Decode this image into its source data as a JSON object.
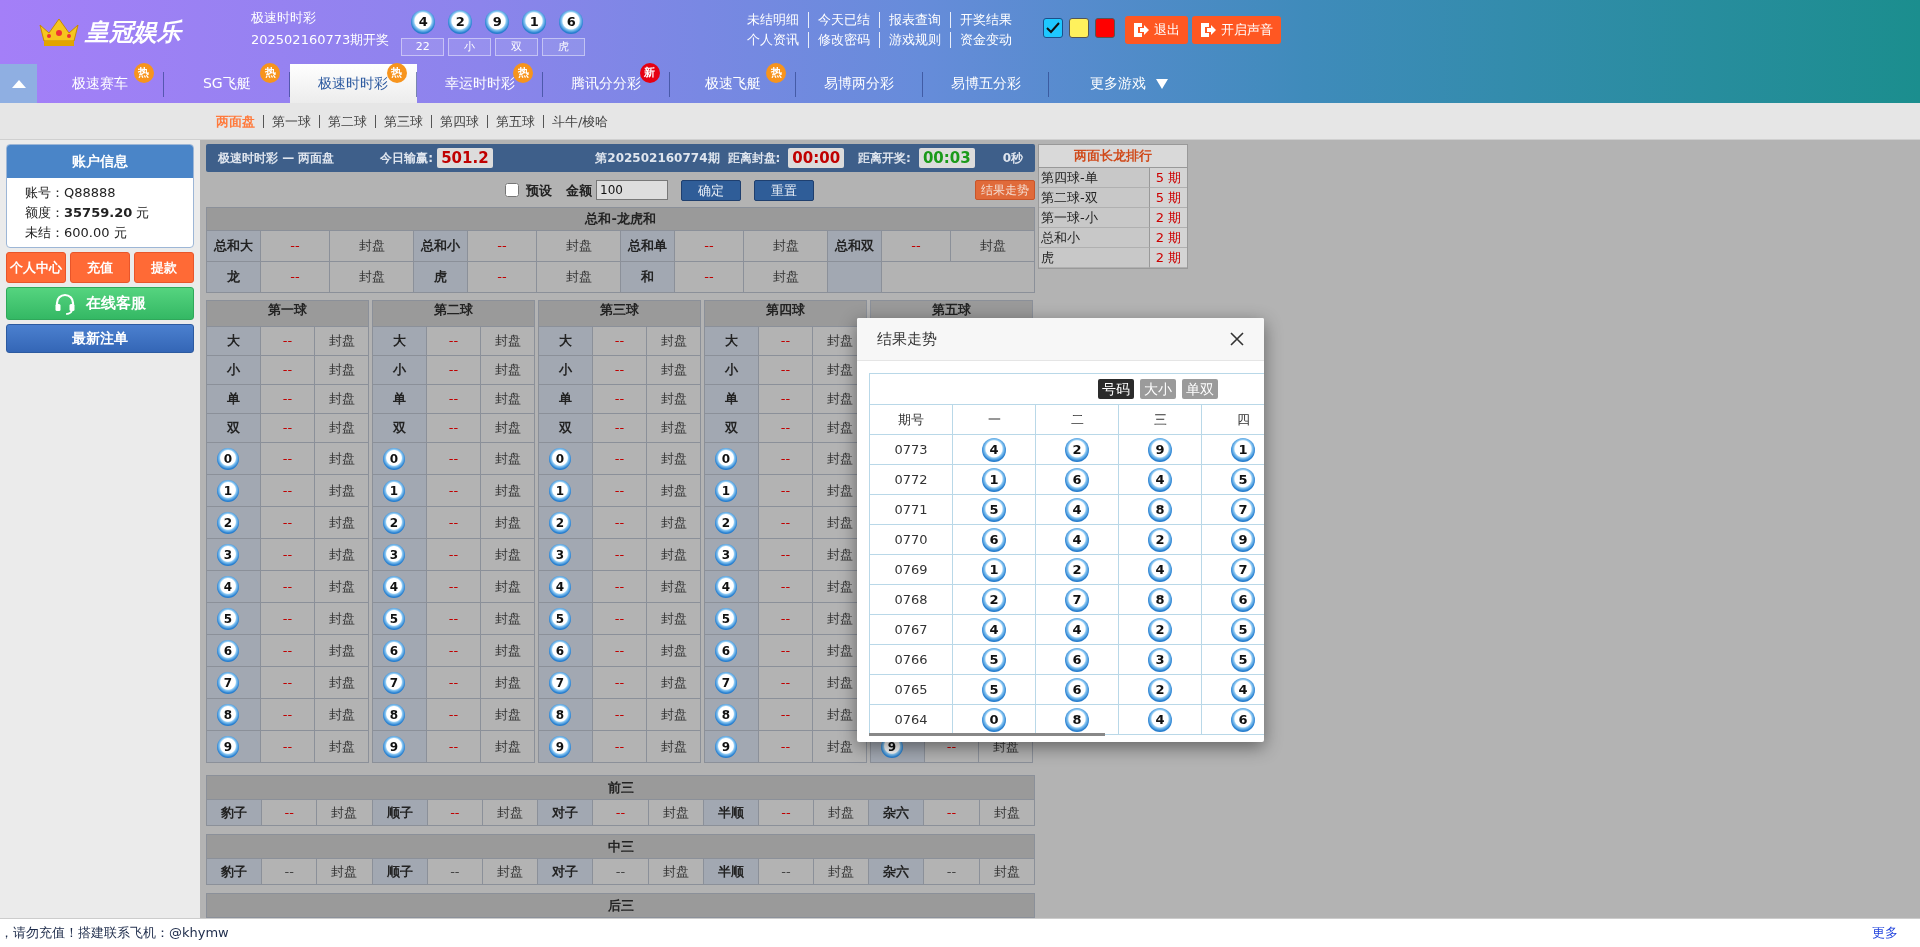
{
  "header": {
    "logo": "皇冠娱乐",
    "game": "极速时时彩",
    "draw_label": "202502160773期开奖",
    "balls": [
      "4",
      "2",
      "9",
      "1",
      "6"
    ],
    "summary": [
      "22",
      "小",
      "双",
      "虎"
    ],
    "links": [
      [
        "未结明细",
        "今天已结",
        "报表查询",
        "开奖结果"
      ],
      [
        "个人资讯",
        "修改密码",
        "游戏规则",
        "资金变动"
      ]
    ],
    "themes": [
      {
        "color": "#1ec8ff",
        "selected": true
      },
      {
        "color": "#fff15c",
        "selected": false
      },
      {
        "color": "#ff0000",
        "selected": false
      }
    ],
    "buttons": [
      "退出",
      "开启声音"
    ]
  },
  "nav": {
    "tabs": [
      {
        "label": "极速赛车",
        "selected": false,
        "badge": {
          "text": "热",
          "color": "#f7941d"
        }
      },
      {
        "label": "SG飞艇",
        "selected": false,
        "badge": {
          "text": "热",
          "color": "#f7941d"
        }
      },
      {
        "label": "极速时时彩",
        "selected": true,
        "badge": {
          "text": "热",
          "color": "#f7941d"
        }
      },
      {
        "label": "幸运时时彩",
        "selected": false,
        "badge": {
          "text": "热",
          "color": "#f7941d"
        }
      },
      {
        "label": "腾讯分分彩",
        "selected": false,
        "badge": {
          "text": "新",
          "color": "#e60012"
        }
      },
      {
        "label": "极速飞艇",
        "selected": false,
        "badge": {
          "text": "热",
          "color": "#f7941d"
        }
      },
      {
        "label": "易博两分彩",
        "selected": false
      },
      {
        "label": "易博五分彩",
        "selected": false
      }
    ],
    "more": "更多游戏"
  },
  "subnav": [
    {
      "label": "两面盘",
      "selected": true
    },
    {
      "label": "第一球",
      "selected": false
    },
    {
      "label": "第二球",
      "selected": false
    },
    {
      "label": "第三球",
      "selected": false
    },
    {
      "label": "第四球",
      "selected": false
    },
    {
      "label": "第五球",
      "selected": false
    },
    {
      "label": "斗牛/梭哈",
      "selected": false
    }
  ],
  "account": {
    "title": "账户信息",
    "lines": [
      "账号：Q88888",
      "额度：**35759.20** 元",
      "未结：600.00 元"
    ],
    "buttons": [
      "个人中心",
      "充值",
      "提款"
    ],
    "service": "在线客服",
    "latest": "最新注单"
  },
  "info_bar": {
    "title": "极速时时彩 — 两面盘",
    "profit_label": "今日输赢:",
    "profit": "501.2",
    "period": "第202502160774期",
    "close_label": "距离封盘:",
    "close_time": "00:00",
    "open_label": "距离开奖:",
    "open_time": "00:03",
    "seconds": "0秒"
  },
  "controls": {
    "preset": {
      "label": "预设",
      "checked": false
    },
    "amount_label": "金额",
    "amount": "100",
    "buttons": [
      "确定",
      "重置"
    ],
    "trend_button": "结果走势"
  },
  "sum_table": {
    "title": "总和-龙虎和",
    "rows": [
      [
        {
          "label": "总和大",
          "odds": "--",
          "status": "封盘"
        },
        {
          "label": "总和小",
          "odds": "--",
          "status": "封盘"
        },
        {
          "label": "总和单",
          "odds": "--",
          "status": "封盘"
        },
        {
          "label": "总和双",
          "odds": "--",
          "status": "封盘"
        }
      ],
      [
        {
          "label": "龙",
          "odds": "--",
          "status": "封盘"
        },
        {
          "label": "虎",
          "odds": "--",
          "status": "封盘"
        },
        {
          "label": "和",
          "odds": "--",
          "status": "封盘"
        }
      ]
    ]
  },
  "ball_tables": [
    {
      "title": "第一球",
      "rows": [
        {
          "kind": "text",
          "label": "大",
          "odds": "--",
          "status": "封盘"
        },
        {
          "kind": "text",
          "label": "小",
          "odds": "--",
          "status": "封盘"
        },
        {
          "kind": "text",
          "label": "单",
          "odds": "--",
          "status": "封盘"
        },
        {
          "kind": "text",
          "label": "双",
          "odds": "--",
          "status": "封盘"
        },
        {
          "kind": "ball",
          "label": "0",
          "odds": "--",
          "status": "封盘"
        },
        {
          "kind": "ball",
          "label": "1",
          "odds": "--",
          "status": "封盘"
        },
        {
          "kind": "ball",
          "label": "2",
          "odds": "--",
          "status": "封盘"
        },
        {
          "kind": "ball",
          "label": "3",
          "odds": "--",
          "status": "封盘"
        },
        {
          "kind": "ball",
          "label": "4",
          "odds": "--",
          "status": "封盘"
        },
        {
          "kind": "ball",
          "label": "5",
          "odds": "--",
          "status": "封盘"
        },
        {
          "kind": "ball",
          "label": "6",
          "odds": "--",
          "status": "封盘"
        },
        {
          "kind": "ball",
          "label": "7",
          "odds": "--",
          "status": "封盘"
        },
        {
          "kind": "ball",
          "label": "8",
          "odds": "--",
          "status": "封盘"
        },
        {
          "kind": "ball",
          "label": "9",
          "odds": "--",
          "status": "封盘"
        }
      ]
    },
    {
      "title": "第二球",
      "rows": [
        {
          "kind": "text",
          "label": "大",
          "odds": "--",
          "status": "封盘"
        },
        {
          "kind": "text",
          "label": "小",
          "odds": "--",
          "status": "封盘"
        },
        {
          "kind": "text",
          "label": "单",
          "odds": "--",
          "status": "封盘"
        },
        {
          "kind": "text",
          "label": "双",
          "odds": "--",
          "status": "封盘"
        },
        {
          "kind": "ball",
          "label": "0",
          "odds": "--",
          "status": "封盘"
        },
        {
          "kind": "ball",
          "label": "1",
          "odds": "--",
          "status": "封盘"
        },
        {
          "kind": "ball",
          "label": "2",
          "odds": "--",
          "status": "封盘"
        },
        {
          "kind": "ball",
          "label": "3",
          "odds": "--",
          "status": "封盘"
        },
        {
          "kind": "ball",
          "label": "4",
          "odds": "--",
          "status": "封盘"
        },
        {
          "kind": "ball",
          "label": "5",
          "odds": "--",
          "status": "封盘"
        },
        {
          "kind": "ball",
          "label": "6",
          "odds": "--",
          "status": "封盘"
        },
        {
          "kind": "ball",
          "label": "7",
          "odds": "--",
          "status": "封盘"
        },
        {
          "kind": "ball",
          "label": "8",
          "odds": "--",
          "status": "封盘"
        },
        {
          "kind": "ball",
          "label": "9",
          "odds": "--",
          "status": "封盘"
        }
      ]
    },
    {
      "title": "第三球",
      "rows": [
        {
          "kind": "text",
          "label": "大",
          "odds": "--",
          "status": "封盘"
        },
        {
          "kind": "text",
          "label": "小",
          "odds": "--",
          "status": "封盘"
        },
        {
          "kind": "text",
          "label": "单",
          "odds": "--",
          "status": "封盘"
        },
        {
          "kind": "text",
          "label": "双",
          "odds": "--",
          "status": "封盘"
        },
        {
          "kind": "ball",
          "label": "0",
          "odds": "--",
          "status": "封盘"
        },
        {
          "kind": "ball",
          "label": "1",
          "odds": "--",
          "status": "封盘"
        },
        {
          "kind": "ball",
          "label": "2",
          "odds": "--",
          "status": "封盘"
        },
        {
          "kind": "ball",
          "label": "3",
          "odds": "--",
          "status": "封盘"
        },
        {
          "kind": "ball",
          "label": "4",
          "odds": "--",
          "status": "封盘"
        },
        {
          "kind": "ball",
          "label": "5",
          "odds": "--",
          "status": "封盘"
        },
        {
          "kind": "ball",
          "label": "6",
          "odds": "--",
          "status": "封盘"
        },
        {
          "kind": "ball",
          "label": "7",
          "odds": "--",
          "status": "封盘"
        },
        {
          "kind": "ball",
          "label": "8",
          "odds": "--",
          "status": "封盘"
        },
        {
          "kind": "ball",
          "label": "9",
          "odds": "--",
          "status": "封盘"
        }
      ]
    },
    {
      "title": "第四球",
      "rows": [
        {
          "kind": "text",
          "label": "大",
          "odds": "--",
          "status": "封盘"
        },
        {
          "kind": "text",
          "label": "小",
          "odds": "--",
          "status": "封盘"
        },
        {
          "kind": "text",
          "label": "单",
          "odds": "--",
          "status": "封盘"
        },
        {
          "kind": "text",
          "label": "双",
          "odds": "--",
          "status": "封盘"
        },
        {
          "kind": "ball",
          "label": "0",
          "odds": "--",
          "status": "封盘"
        },
        {
          "kind": "ball",
          "label": "1",
          "odds": "--",
          "status": "封盘"
        },
        {
          "kind": "ball",
          "label": "2",
          "odds": "--",
          "status": "封盘"
        },
        {
          "kind": "ball",
          "label": "3",
          "odds": "--",
          "status": "封盘"
        },
        {
          "kind": "ball",
          "label": "4",
          "odds": "--",
          "status": "封盘"
        },
        {
          "kind": "ball",
          "label": "5",
          "odds": "--",
          "status": "封盘"
        },
        {
          "kind": "ball",
          "label": "6",
          "odds": "--",
          "status": "封盘"
        },
        {
          "kind": "ball",
          "label": "7",
          "odds": "--",
          "status": "封盘"
        },
        {
          "kind": "ball",
          "label": "8",
          "odds": "--",
          "status": "封盘"
        },
        {
          "kind": "ball",
          "label": "9",
          "odds": "--",
          "status": "封盘"
        }
      ]
    },
    {
      "title": "第五球",
      "rows": [
        {
          "kind": "ball",
          "label": "9",
          "odds": "--",
          "status": "封盘"
        }
      ]
    }
  ],
  "sections": [
    {
      "title": "前三",
      "active": true,
      "cells": [
        {
          "label": "豹子",
          "odds": "--",
          "status": "封盘"
        },
        {
          "label": "顺子",
          "odds": "--",
          "status": "封盘"
        },
        {
          "label": "对子",
          "odds": "--",
          "status": "封盘"
        },
        {
          "label": "半顺",
          "odds": "--",
          "status": "封盘"
        },
        {
          "label": "杂六",
          "odds": "--",
          "status": "封盘"
        }
      ]
    },
    {
      "title": "中三",
      "active": false,
      "cells": [
        {
          "label": "豹子",
          "odds": "--",
          "status": "封盘"
        },
        {
          "label": "顺子",
          "odds": "--",
          "status": "封盘"
        },
        {
          "label": "对子",
          "odds": "--",
          "status": "封盘"
        },
        {
          "label": "半顺",
          "odds": "--",
          "status": "封盘"
        },
        {
          "label": "杂六",
          "odds": "--",
          "status": "封盘"
        }
      ]
    },
    {
      "title": "后三"
    }
  ],
  "dragon_rank": {
    "title": "两面长龙排行",
    "rows": [
      {
        "name": "第四球-单",
        "count": "5 期"
      },
      {
        "name": "第二球-双",
        "count": "5 期"
      },
      {
        "name": "第一球-小",
        "count": "2 期"
      },
      {
        "name": "总和小",
        "count": "2 期"
      },
      {
        "name": "虎",
        "count": "2 期"
      }
    ]
  },
  "modal": {
    "title": "结果走势",
    "modes": [
      {
        "label": "号码",
        "selected": true
      },
      {
        "label": "大小",
        "selected": false
      },
      {
        "label": "单双",
        "selected": false
      }
    ],
    "columns": [
      "期号",
      "一",
      "二",
      "三",
      "四"
    ],
    "rows": [
      {
        "period": "0773",
        "balls": [
          "4",
          "2",
          "9",
          "1"
        ]
      },
      {
        "period": "0772",
        "balls": [
          "1",
          "6",
          "4",
          "5"
        ]
      },
      {
        "period": "0771",
        "balls": [
          "5",
          "4",
          "8",
          "7"
        ]
      },
      {
        "period": "0770",
        "balls": [
          "6",
          "4",
          "2",
          "9"
        ]
      },
      {
        "period": "0769",
        "balls": [
          "1",
          "2",
          "4",
          "7"
        ]
      },
      {
        "period": "0768",
        "balls": [
          "2",
          "7",
          "8",
          "6"
        ]
      },
      {
        "period": "0767",
        "balls": [
          "4",
          "4",
          "2",
          "5"
        ]
      },
      {
        "period": "0766",
        "balls": [
          "5",
          "6",
          "3",
          "5"
        ]
      },
      {
        "period": "0765",
        "balls": [
          "5",
          "6",
          "2",
          "4"
        ]
      },
      {
        "period": "0764",
        "balls": [
          "0",
          "8",
          "4",
          "6"
        ]
      }
    ]
  },
  "footer": {
    "notice": "，请勿充值！搭建联系飞机：@khymw",
    "more": "更多"
  }
}
